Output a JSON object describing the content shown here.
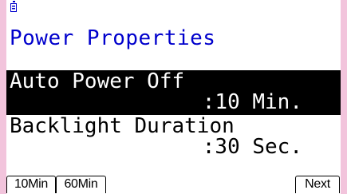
{
  "status_bar": {
    "battery_icon": "battery-icon"
  },
  "header": {
    "title": "Power Properties"
  },
  "settings": [
    {
      "label": "Auto Power Off",
      "value": ":10 Min.",
      "selected": true
    },
    {
      "label": "Backlight Duration",
      "value": ":30 Sec.",
      "selected": false
    }
  ],
  "function_keys": {
    "f1": "10Min",
    "f2": "60Min",
    "f6": "Next"
  },
  "colors": {
    "accent": "#0000cc",
    "background": "#ffffff",
    "bezel": "#f2c4dc",
    "highlight": "#000000",
    "highlight_text": "#ffffff"
  }
}
